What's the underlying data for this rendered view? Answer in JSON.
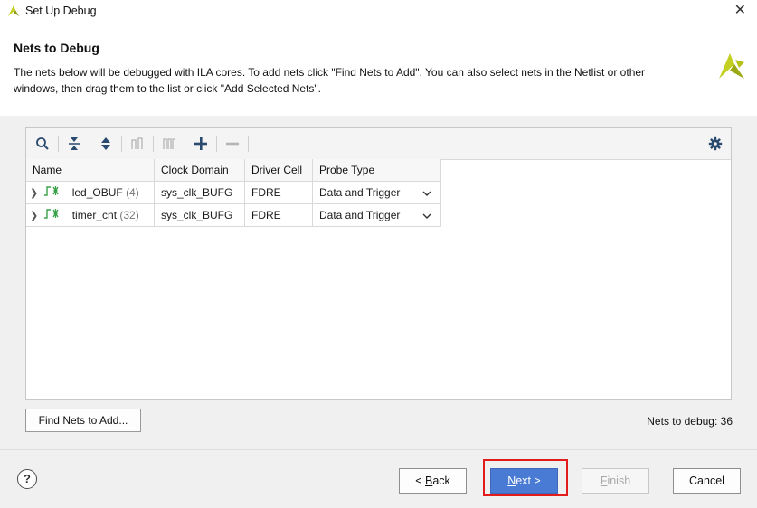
{
  "window": {
    "title": "Set Up Debug",
    "close_glyph": "✕"
  },
  "header": {
    "title": "Nets to Debug",
    "description": "The nets below will be debugged with ILA cores. To add nets click \"Find Nets to Add\". You can also select nets in the Netlist or other windows, then drag them to the list or click \"Add Selected Nets\"."
  },
  "toolbar": {
    "icons": [
      "search-icon",
      "collapse-all-icon",
      "expand-all-icon",
      "net-filter-icon",
      "bus-icon",
      "add-icon",
      "remove-icon",
      "gear-icon"
    ]
  },
  "table": {
    "columns": [
      "Name",
      "Clock Domain",
      "Driver Cell",
      "Probe Type"
    ],
    "rows": [
      {
        "name": "led_OBUF",
        "count": "(4)",
        "clock": "sys_clk_BUFG",
        "driver": "FDRE",
        "probe": "Data and Trigger"
      },
      {
        "name": "timer_cnt",
        "count": "(32)",
        "clock": "sys_clk_BUFG",
        "driver": "FDRE",
        "probe": "Data and Trigger"
      }
    ]
  },
  "find_button": "Find Nets to Add...",
  "nets_count": "Nets to debug: 36",
  "buttons": {
    "help": "?",
    "back_prefix": "< ",
    "back_accel": "B",
    "back_rest": "ack",
    "next_accel": "N",
    "next_rest": "ext >",
    "finish_accel": "F",
    "finish_rest": "inish",
    "cancel": "Cancel"
  },
  "colors": {
    "accent": "#4a7bd4",
    "highlight": "#e21b1b",
    "logo": "#c3cf21"
  }
}
